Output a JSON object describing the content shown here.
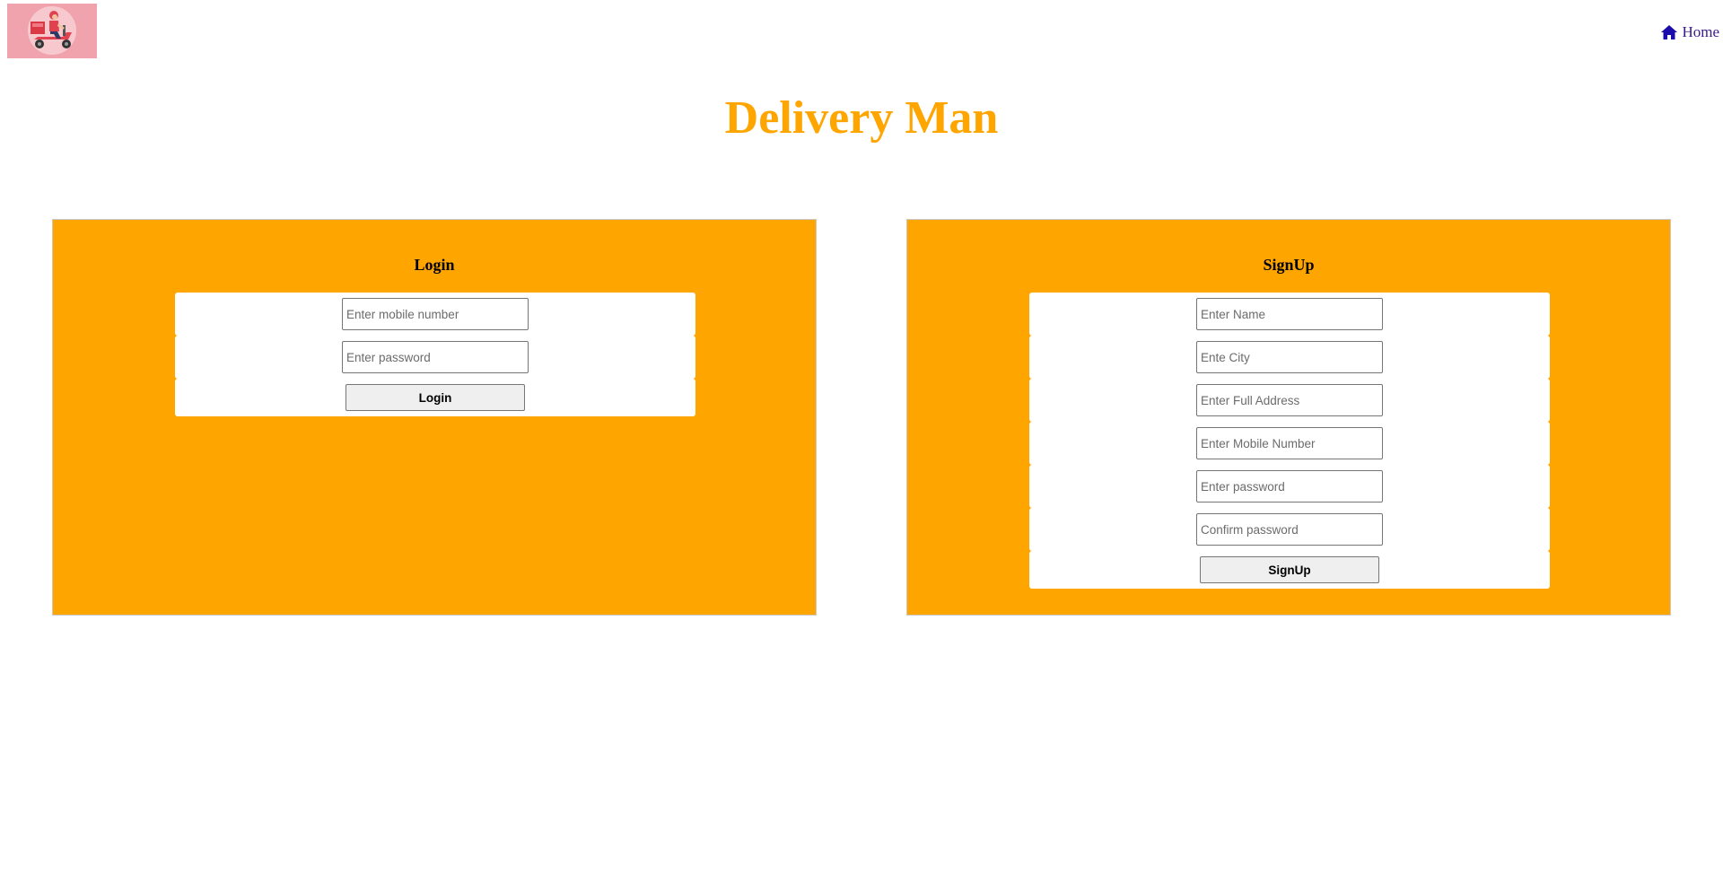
{
  "header": {
    "logo_icon": "delivery-scooter-logo",
    "home_icon": "home-icon",
    "home_label": "Home"
  },
  "page_title": "Delivery Man",
  "colors": {
    "accent": "#ffa500",
    "logo_bg": "#f0a3ad",
    "link": "#1a0dab"
  },
  "login": {
    "heading": "Login",
    "fields": [
      {
        "placeholder": "Enter mobile number",
        "value": ""
      },
      {
        "placeholder": "Enter password",
        "value": ""
      }
    ],
    "button_label": "Login"
  },
  "signup": {
    "heading": "SignUp",
    "fields": [
      {
        "placeholder": "Enter Name",
        "value": ""
      },
      {
        "placeholder": "Ente City",
        "value": ""
      },
      {
        "placeholder": "Enter Full Address",
        "value": ""
      },
      {
        "placeholder": "Enter Mobile Number",
        "value": ""
      },
      {
        "placeholder": "Enter password",
        "value": ""
      },
      {
        "placeholder": "Confirm password",
        "value": ""
      }
    ],
    "button_label": "SignUp"
  }
}
